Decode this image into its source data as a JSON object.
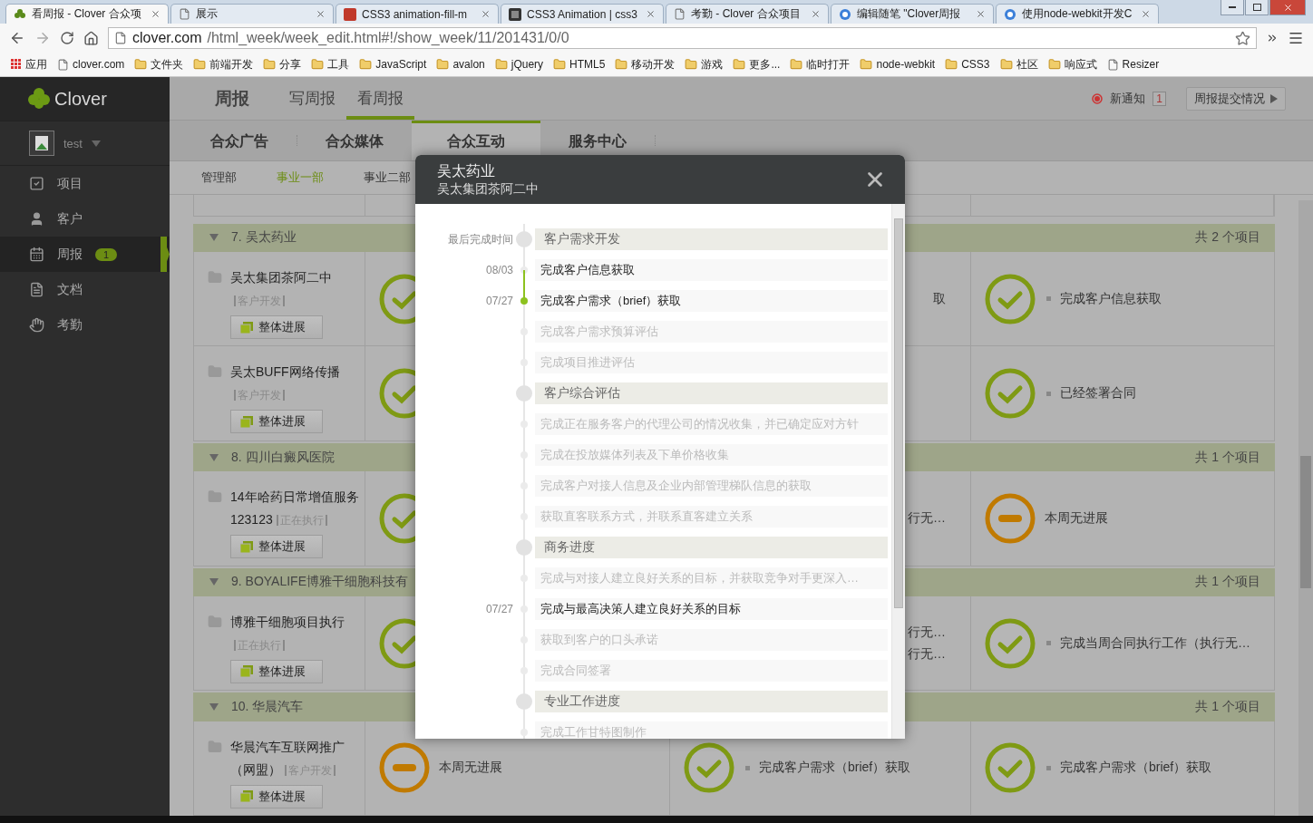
{
  "browser": {
    "tabs": [
      {
        "title": "看周报 - Clover 合众项",
        "kind": "clover",
        "selected": true
      },
      {
        "title": "展示",
        "kind": "page",
        "selected": false
      },
      {
        "title": "CSS3 animation-fill-m",
        "kind": "w3",
        "selected": false
      },
      {
        "title": "CSS3 Animation | css3",
        "kind": "dark",
        "selected": false
      },
      {
        "title": "考勤 - Clover 合众项目",
        "kind": "page",
        "selected": false
      },
      {
        "title": "编辑随笔 \"Clover周报",
        "kind": "globe",
        "selected": false
      },
      {
        "title": "使用node-webkit开发C",
        "kind": "globe",
        "selected": false
      }
    ],
    "url": {
      "host": "clover.com",
      "path": "/html_week/week_edit.html#!/show_week/11/201431/0/0"
    },
    "bookmarks": [
      {
        "label": "应用",
        "kind": "apps"
      },
      {
        "label": "clover.com",
        "kind": "page"
      },
      {
        "label": "文件夹",
        "kind": "folder"
      },
      {
        "label": "前端开发",
        "kind": "folder"
      },
      {
        "label": "分享",
        "kind": "folder"
      },
      {
        "label": "工具",
        "kind": "folder"
      },
      {
        "label": "JavaScript",
        "kind": "folder"
      },
      {
        "label": "avalon",
        "kind": "folder"
      },
      {
        "label": "jQuery",
        "kind": "folder"
      },
      {
        "label": "HTML5",
        "kind": "folder"
      },
      {
        "label": "移动开发",
        "kind": "folder"
      },
      {
        "label": "游戏",
        "kind": "folder"
      },
      {
        "label": "更多...",
        "kind": "folder"
      },
      {
        "label": "临时打开",
        "kind": "folder"
      },
      {
        "label": "node-webkit",
        "kind": "folder"
      },
      {
        "label": "CSS3",
        "kind": "folder"
      },
      {
        "label": "社区",
        "kind": "folder"
      },
      {
        "label": "响应式",
        "kind": "folder"
      },
      {
        "label": "Resizer",
        "kind": "page"
      }
    ]
  },
  "sidebar": {
    "logo": "Clover",
    "user": "test",
    "items": [
      {
        "label": "项目",
        "kind": "check",
        "selected": false
      },
      {
        "label": "客户",
        "kind": "user",
        "selected": false
      },
      {
        "label": "周报",
        "kind": "calendar",
        "selected": true,
        "badge": "1"
      },
      {
        "label": "文档",
        "kind": "doc",
        "selected": false
      },
      {
        "label": "考勤",
        "kind": "hand",
        "selected": false
      }
    ]
  },
  "header": {
    "title": "周报",
    "tabs": [
      {
        "label": "写周报",
        "selected": false
      },
      {
        "label": "看周报",
        "selected": true
      }
    ],
    "notice": "新通知",
    "notice_count": "1",
    "report_button": "周报提交情况"
  },
  "company_tabs": [
    {
      "label": "合众广告",
      "selected": false
    },
    {
      "label": "合众媒体",
      "selected": false
    },
    {
      "label": "合众互动",
      "selected": true
    },
    {
      "label": "服务中心",
      "selected": false
    }
  ],
  "dept_tabs": [
    {
      "label": "管理部",
      "selected": false
    },
    {
      "label": "事业一部",
      "selected": true
    },
    {
      "label": "事业二部",
      "selected": false
    }
  ],
  "groups": [
    {
      "title": "7. 吴太药业",
      "count": "共 2 个项目",
      "rows": [
        {
          "project": "吴太集团茶阿二中",
          "tag": "客户开发",
          "button": "整体进展",
          "col2": {
            "kind": "done"
          },
          "col3": {
            "lines": [
              "取"
            ]
          },
          "col4": {
            "kind": "done",
            "text": "完成客户信息获取"
          }
        },
        {
          "project": "吴太BUFF网络传播",
          "tag": "客户开发",
          "button": "整体进展",
          "col2": {
            "kind": "done"
          },
          "col4": {
            "kind": "done",
            "text": "已经签署合同"
          }
        }
      ]
    },
    {
      "title": "8. 四川白癜风医院",
      "count": "共 1 个项目",
      "rows": [
        {
          "project": "14年哈药日常增值服务123123",
          "tag": "正在执行",
          "button": "整体进展",
          "col2": {
            "kind": "done"
          },
          "col3": {
            "lines": [
              "行无…"
            ]
          },
          "col4": {
            "kind": "none",
            "text": "本周无进展"
          }
        }
      ]
    },
    {
      "title": "9. BOYALIFE博雅干细胞科技有",
      "count": "共 1 个项目",
      "rows": [
        {
          "project": "博雅干细胞项目执行",
          "tag": "正在执行",
          "button": "整体进展",
          "col2": {
            "kind": "done"
          },
          "col3": {
            "lines": [
              "行无…",
              "行无…"
            ]
          },
          "col4": {
            "kind": "done",
            "text": "完成当周合同执行工作（执行无…"
          }
        }
      ]
    },
    {
      "title": "10. 华晨汽车",
      "count": "共 1 个项目",
      "rows": [
        {
          "project": "华晨汽车互联网推广（网盟）",
          "tag": "客户开发",
          "button": "整体进展",
          "col2": {
            "kind": "none",
            "text": "本周无进展"
          },
          "col3": {
            "kind": "done",
            "text": "完成客户需求（brief）获取"
          },
          "col4": {
            "kind": "done",
            "text": "完成客户需求（brief）获取"
          }
        }
      ]
    }
  ],
  "modal": {
    "title": "吴太药业",
    "subtitle": "吴太集团茶阿二中",
    "items": [
      {
        "kind": "group",
        "text": "客户需求开发",
        "date": "最后完成时间"
      },
      {
        "kind": "task",
        "text": "完成客户信息获取",
        "date": "08/03",
        "done": true,
        "current": false
      },
      {
        "kind": "task",
        "text": "完成客户需求（brief）获取",
        "date": "07/27",
        "done": true,
        "current": true
      },
      {
        "kind": "task",
        "text": "完成客户需求预算评估",
        "done": false,
        "current": false
      },
      {
        "kind": "task",
        "text": "完成项目推进评估",
        "done": false,
        "current": false
      },
      {
        "kind": "group",
        "text": "客户综合评估"
      },
      {
        "kind": "task",
        "text": "完成正在服务客户的代理公司的情况收集，并已确定应对方针",
        "done": false,
        "current": false
      },
      {
        "kind": "task",
        "text": "完成在投放媒体列表及下单价格收集",
        "done": false,
        "current": false
      },
      {
        "kind": "task",
        "text": "完成客户对接人信息及企业内部管理梯队信息的获取",
        "done": false,
        "current": false
      },
      {
        "kind": "task",
        "text": "获取直客联系方式，并联系直客建立关系",
        "done": false,
        "current": false
      },
      {
        "kind": "group",
        "text": "商务进度"
      },
      {
        "kind": "task",
        "text": "完成与对接人建立良好关系的目标，并获取竞争对手更深入…",
        "done": false,
        "current": false
      },
      {
        "kind": "task",
        "text": "完成与最高决策人建立良好关系的目标",
        "date": "07/27",
        "done": true,
        "current": false
      },
      {
        "kind": "task",
        "text": "获取到客户的口头承诺",
        "done": false,
        "current": false
      },
      {
        "kind": "task",
        "text": "完成合同签署",
        "done": false,
        "current": false
      },
      {
        "kind": "group",
        "text": "专业工作进度"
      },
      {
        "kind": "task",
        "text": "完成工作甘特图制作",
        "done": false,
        "current": false
      }
    ]
  }
}
